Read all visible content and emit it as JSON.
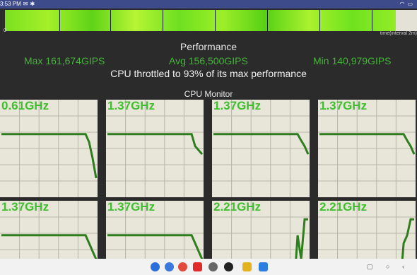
{
  "status_bar": {
    "time": "3:53 PM"
  },
  "graph": {
    "zero_label": "0",
    "time_label": "time(interval 2m)"
  },
  "performance": {
    "title": "Performance",
    "max": "Max 161,674GIPS",
    "avg": "Avg 156,500GIPS",
    "min": "Min 140,979GIPS",
    "throttle": "CPU throttled to 93% of its max performance"
  },
  "cpu_monitor": {
    "title": "CPU Monitor",
    "cores": [
      {
        "freq": "0.61GHz",
        "trace": [
          0.7,
          0.7,
          0.7,
          0.7,
          0.7,
          0.7,
          0.7,
          0.7,
          0.7,
          0.7,
          0.7,
          0.7,
          0.7,
          0.7,
          0.7,
          0.7,
          0.7,
          0.7,
          0.7,
          0.7,
          0.7,
          0.7,
          0.7,
          0.7,
          0.7,
          0.6,
          0.4,
          0.15
        ]
      },
      {
        "freq": "1.37GHz",
        "trace": [
          0.7,
          0.7,
          0.7,
          0.7,
          0.7,
          0.7,
          0.7,
          0.7,
          0.7,
          0.7,
          0.7,
          0.7,
          0.7,
          0.7,
          0.7,
          0.7,
          0.7,
          0.7,
          0.7,
          0.7,
          0.7,
          0.7,
          0.7,
          0.7,
          0.7,
          0.55,
          0.5,
          0.45
        ]
      },
      {
        "freq": "1.37GHz",
        "trace": [
          0.7,
          0.7,
          0.7,
          0.7,
          0.7,
          0.7,
          0.7,
          0.7,
          0.7,
          0.7,
          0.7,
          0.7,
          0.7,
          0.7,
          0.7,
          0.7,
          0.7,
          0.7,
          0.7,
          0.7,
          0.7,
          0.7,
          0.7,
          0.7,
          0.7,
          0.62,
          0.55,
          0.45
        ]
      },
      {
        "freq": "1.37GHz",
        "trace": [
          0.7,
          0.7,
          0.7,
          0.7,
          0.7,
          0.7,
          0.7,
          0.7,
          0.7,
          0.7,
          0.7,
          0.7,
          0.7,
          0.7,
          0.7,
          0.7,
          0.7,
          0.7,
          0.7,
          0.7,
          0.7,
          0.7,
          0.7,
          0.7,
          0.7,
          0.62,
          0.55,
          0.45
        ]
      },
      {
        "freq": "1.37GHz",
        "trace": [
          0.7,
          0.7,
          0.7,
          0.7,
          0.7,
          0.7,
          0.7,
          0.7,
          0.7,
          0.7,
          0.7,
          0.7,
          0.7,
          0.7,
          0.7,
          0.7,
          0.7,
          0.7,
          0.7,
          0.7,
          0.7,
          0.7,
          0.7,
          0.7,
          0.7,
          0.6,
          0.5,
          0.4
        ]
      },
      {
        "freq": "1.37GHz",
        "trace": [
          0.7,
          0.7,
          0.7,
          0.7,
          0.7,
          0.7,
          0.7,
          0.7,
          0.7,
          0.7,
          0.7,
          0.7,
          0.7,
          0.7,
          0.7,
          0.7,
          0.7,
          0.7,
          0.7,
          0.7,
          0.7,
          0.7,
          0.7,
          0.7,
          0.7,
          0.6,
          0.5,
          0.4
        ]
      },
      {
        "freq": "2.21GHz",
        "trace": [
          0.05,
          0.05,
          0.05,
          0.05,
          0.05,
          0.05,
          0.05,
          0.05,
          0.05,
          0.05,
          0.05,
          0.05,
          0.05,
          0.05,
          0.35,
          0.05,
          0.05,
          0.05,
          0.05,
          0.3,
          0.05,
          0.05,
          0.05,
          0.05,
          0.7,
          0.4,
          0.9,
          0.9
        ]
      },
      {
        "freq": "2.21GHz",
        "trace": [
          0.05,
          0.05,
          0.05,
          0.05,
          0.05,
          0.05,
          0.05,
          0.05,
          0.05,
          0.05,
          0.05,
          0.05,
          0.05,
          0.05,
          0.3,
          0.05,
          0.05,
          0.05,
          0.05,
          0.3,
          0.05,
          0.05,
          0.05,
          0.05,
          0.6,
          0.7,
          0.9,
          0.9
        ]
      }
    ]
  },
  "colors": {
    "trace": "#2e7d1e",
    "freq": "#3fbe2f",
    "stat": "#46b33a"
  }
}
